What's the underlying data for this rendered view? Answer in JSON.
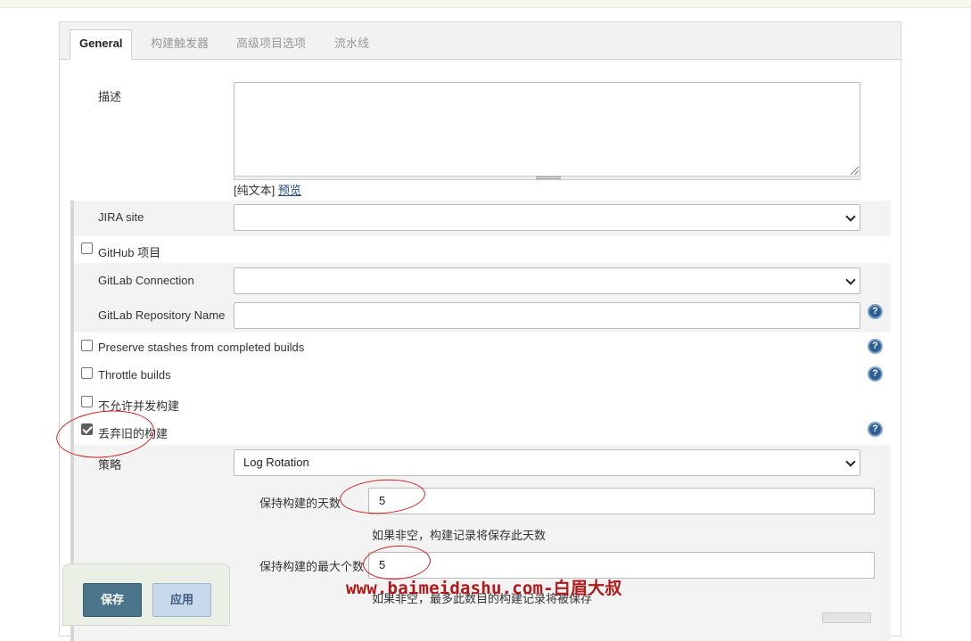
{
  "tabs": [
    {
      "label": "General"
    },
    {
      "label": "构建触发器"
    },
    {
      "label": "高级项目选项"
    },
    {
      "label": "流水线"
    }
  ],
  "description": {
    "label": "描述",
    "value": "",
    "plain_text": "[纯文本]",
    "preview_link": "预览"
  },
  "jira": {
    "label": "JIRA site",
    "value": ""
  },
  "github_project": {
    "label": "GitHub 项目",
    "checked": false
  },
  "gitlab_connection": {
    "label": "GitLab Connection",
    "value": ""
  },
  "gitlab_repo": {
    "label": "GitLab Repository Name",
    "value": ""
  },
  "preserve_stashes": {
    "label": "Preserve stashes from completed builds",
    "checked": false
  },
  "throttle_builds": {
    "label": "Throttle builds",
    "checked": false
  },
  "disallow_concurrent": {
    "label": "不允许并发构建",
    "checked": false
  },
  "discard_old": {
    "label": "丢弃旧的构建",
    "checked": true
  },
  "strategy": {
    "label": "策略",
    "value": "Log Rotation"
  },
  "days_to_keep": {
    "label": "保持构建的天数",
    "value": "5",
    "hint": "如果非空，构建记录将保存此天数"
  },
  "max_builds": {
    "label": "保持构建的最大个数",
    "value": "5",
    "hint": "如果非空，最多此数目的构建记录将被保存"
  },
  "buttons": {
    "save": "保存",
    "apply": "应用"
  },
  "help_icon_text": "?",
  "watermark": "www.baimeidashu.com-白眉大叔",
  "colors": {
    "accent_save": "#4b758b",
    "annotation_red": "#d42121"
  }
}
